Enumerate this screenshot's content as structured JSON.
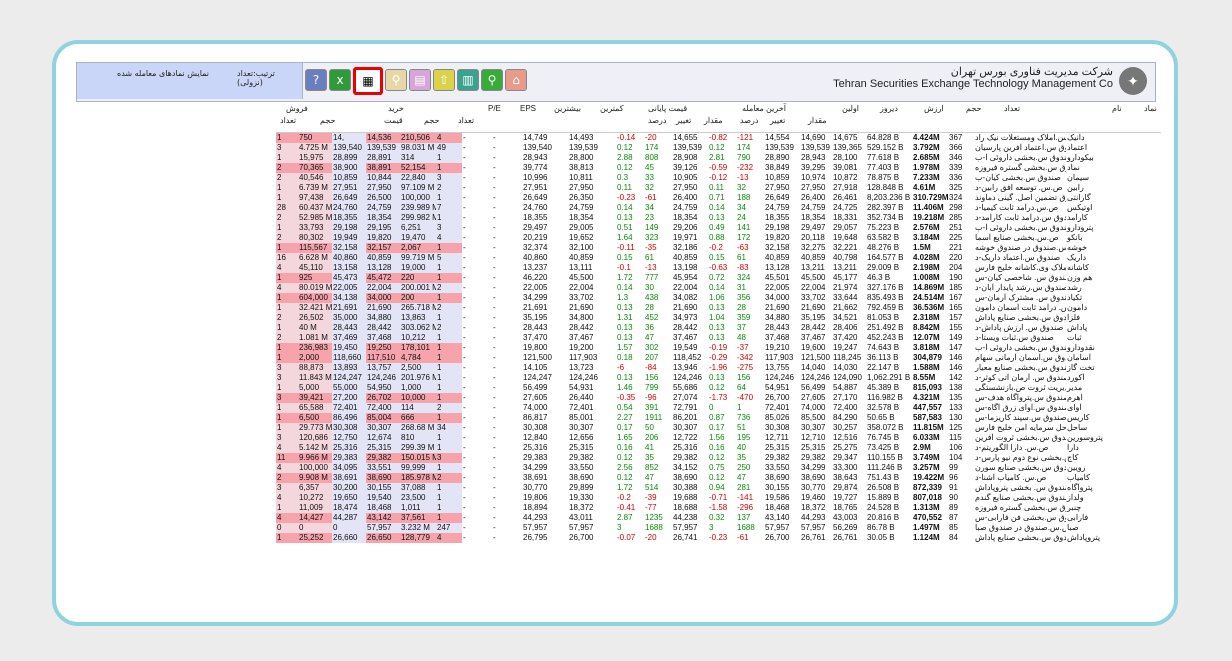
{
  "header": {
    "company_fa": "شرکت مدیریت فناوری بورس تهران",
    "company_en": "Tehran Securities Exchange Technology Management Co",
    "show_traded": "نمایش نمادهای معامله شده",
    "sort_label": "ترتیب:تعداد (نزولی)"
  },
  "toolbar": [
    "?",
    "x",
    "▦",
    "▥",
    "▤",
    "⌂",
    "▣",
    "⚲",
    "⌂"
  ],
  "columns": {
    "sell_group": "فروش",
    "sell_count": "تعداد",
    "sell_volume": "حجم",
    "buy_group": "خرید",
    "buy_price": "قیمت",
    "buy_volume": "حجم",
    "buy_count": "تعداد",
    "pe": "P/E",
    "eps": "EPS",
    "max": "بیشترین",
    "min": "کمترین",
    "close_group": "قیمت پایانی",
    "close_pct": "درصد",
    "close_change": "تغییر",
    "last_group": "آخرین معامله",
    "last_amount": "مقدار",
    "last_pct": "درصد",
    "last_change": "تغییر",
    "amount": "مقدار",
    "first": "اولین",
    "yesterday": "دیروز",
    "value": "ارزش",
    "volume": "حجم",
    "count": "تعداد",
    "name": "نام",
    "symbol": "نماد"
  },
  "rows": [
    [
      "1",
      "750",
      "14,",
      "14,536",
      "210,506",
      "4",
      "-",
      "-",
      "14,749",
      "14,493",
      "-0.14",
      "-20",
      "14,655",
      "-0.82",
      "-121",
      "14,554",
      "14,690",
      "14,675",
      "64.828 B",
      "4.424M",
      "367",
      "ص.س.املاک ومستغلات نیک راد",
      "دانیک"
    ],
    [
      "3",
      "4.725 M",
      "139,540",
      "139,539",
      "98.031 M",
      "49",
      "-",
      "-",
      "139,540",
      "139,539",
      "0.12",
      "174",
      "139,539",
      "0.12",
      "174",
      "139,539",
      "139,539",
      "139,365",
      "529.152 B",
      "3.792M",
      "366",
      "صندوق س.اعتماد آفرین پارسیان",
      "اعتماد"
    ],
    [
      "1",
      "15,975",
      "28,899",
      "28,891",
      "314",
      "1",
      "-",
      "-",
      "28,943",
      "28,800",
      "2.88",
      "808",
      "28,908",
      "2.81",
      "790",
      "28,890",
      "28,943",
      "28,100",
      "77.618 B",
      "2.685M",
      "346",
      "صندوق س.بخشی داروئی آ-ب",
      "بیکودارو"
    ],
    [
      "2",
      "70,365",
      "38,900",
      "38,891",
      "52,154",
      "1",
      "-",
      "-",
      "39,774",
      "38,813",
      "0.12",
      "45",
      "39,126",
      "-0.59",
      "-232",
      "38,849",
      "39,295",
      "39,081",
      "77.403 B",
      "1.978M",
      "339",
      "صندوق س.بخشی گستره فیروزه",
      "نماد"
    ],
    [
      "2",
      "40,546",
      "10,859",
      "10,844",
      "22,840",
      "3",
      "-",
      "-",
      "10,996",
      "10,811",
      "0.3",
      "33",
      "10,905",
      "-0.12",
      "-13",
      "10,859",
      "10,974",
      "10,872",
      "78.875 B",
      "7.233M",
      "336",
      "صندوق س.بخشی کیان-ب",
      "سیمان"
    ],
    [
      "1",
      "6.739 M",
      "27,951",
      "27,950",
      "97.109 M",
      "2",
      "-",
      "-",
      "27,951",
      "27,950",
      "0.11",
      "32",
      "27,950",
      "0.11",
      "32",
      "27,950",
      "27,950",
      "27,918",
      "128.848 B",
      "4.61M",
      "325",
      "ص.س. توسعه افق رابین-د",
      "رابین"
    ],
    [
      "1",
      "97,438",
      "26,649",
      "26,500",
      "100,000",
      "1",
      "-",
      "-",
      "26,649",
      "26,350",
      "-0.23",
      "-61",
      "26,400",
      "0.71",
      "188",
      "26,649",
      "26,400",
      "26,461",
      "8,203.236 B",
      "310.729M",
      "324",
      "صندوق تضمین اصل. گینی دماوند",
      "گارانتی"
    ],
    [
      "28",
      "60.437 M",
      "24,760",
      "24,759",
      "239.989 M",
      "7",
      "-",
      "-",
      "24,760",
      "24,759",
      "0.14",
      "34",
      "24,759",
      "0.14",
      "34",
      "24,759",
      "24,759",
      "24,725",
      "282.397 B",
      "11.406M",
      "298",
      "ص.س.درآمد ثابت کیمیا-د",
      "اوتیکس"
    ],
    [
      "2",
      "52.985 M",
      "18,355",
      "18,354",
      "299.982 M",
      "1",
      "-",
      "-",
      "18,355",
      "18,354",
      "0.13",
      "23",
      "18,354",
      "0.13",
      "24",
      "18,355",
      "18,354",
      "18,331",
      "352.734 B",
      "19.218M",
      "285",
      "صندوق س.درآمد ثابت کارآمد-د",
      "کارآمد"
    ],
    [
      "1",
      "33,793",
      "29,198",
      "29,195",
      "6,251",
      "3",
      "-",
      "-",
      "29,497",
      "29,005",
      "0.51",
      "149",
      "29,206",
      "0.49",
      "141",
      "29,198",
      "29,497",
      "29,057",
      "75.223 B",
      "2.576M",
      "251",
      "صندوق س.بخشی داروئی آ-ب",
      "پترودارو"
    ],
    [
      "2",
      "80,302",
      "19,949",
      "19,820",
      "19,470",
      "4",
      "-",
      "-",
      "20,219",
      "19,652",
      "1.64",
      "323",
      "19,971",
      "0.88",
      "172",
      "19,820",
      "20,118",
      "19,648",
      "63.582 B",
      "3.184M",
      "225",
      "ص.س.بخشی صنایع آسما",
      "بانکو"
    ],
    [
      "1",
      "115,567",
      "32,158",
      "32,157",
      "2,067",
      "1",
      "-",
      "-",
      "32,374",
      "32,100",
      "-0.11",
      "-35",
      "32,186",
      "-0.2",
      "-63",
      "32,158",
      "32,275",
      "32,221",
      "48.276 B",
      "1.5M",
      "221",
      "ص.س.صندوق در صندوق خوشه",
      "خوشه"
    ],
    [
      "16",
      "6.628 M",
      "40,860",
      "40,859",
      "99.719 M",
      "5",
      "-",
      "-",
      "40,860",
      "40,859",
      "0.15",
      "61",
      "40,859",
      "0.15",
      "61",
      "40,859",
      "40,859",
      "40,798",
      "164.577 B",
      "4.028M",
      "220",
      "صندوق س.اعتماد داریک-د",
      "داریک"
    ],
    [
      "4",
      "45,110",
      "13,158",
      "13,128",
      "19,000",
      "1",
      "-",
      "-",
      "13,237",
      "13,111",
      "-0.1",
      "-13",
      "13,198",
      "-0.63",
      "-83",
      "13,128",
      "13,211",
      "13,211",
      "29.009 B",
      "2.198M",
      "204",
      "ص.س. املاک وی.کاشانه خلیج فارس",
      "کاشانه"
    ],
    [
      "1",
      "925",
      "45,473",
      "45,472",
      "220",
      "1",
      "-",
      "-",
      "46,220",
      "45,500",
      "1.72",
      "777",
      "45,954",
      "0.72",
      "324",
      "45,501",
      "45,500",
      "45,177",
      "46.3 B",
      "1.008M",
      "190",
      "صندوق س. شاخصی کیان-س",
      "هم وزن"
    ],
    [
      "4",
      "80.019 M",
      "22,005",
      "22,004",
      "200.001 M",
      "2",
      "-",
      "-",
      "22,005",
      "22,004",
      "0.14",
      "30",
      "22,004",
      "0.14",
      "31",
      "22,005",
      "22,004",
      "21,974",
      "327.176 B",
      "14.869M",
      "185",
      "صندوق س.رشد پایدار آبان-د",
      "رشد"
    ],
    [
      "1",
      "604,000",
      "34,138",
      "34,000",
      "200",
      "1",
      "-",
      "-",
      "34,299",
      "33,702",
      "1.3",
      "438",
      "34,082",
      "1.06",
      "356",
      "34,000",
      "33,702",
      "33,644",
      "835.493 B",
      "24.514M",
      "167",
      "صندوق س. مشترک آرمان-س",
      "تکیاد"
    ],
    [
      "1",
      "32.421 M",
      "21,691",
      "21,690",
      "265.718 M",
      "2",
      "-",
      "-",
      "21,691",
      "21,690",
      "0.13",
      "28",
      "21,690",
      "0.13",
      "28",
      "21,690",
      "21,690",
      "21,662",
      "792.459 B",
      "36.536M",
      "165",
      "ص.س. درآمد ثابت آسمان دامون",
      "دامون"
    ],
    [
      "2",
      "26,502",
      "35,000",
      "34,880",
      "13,863",
      "1",
      "-",
      "-",
      "35,195",
      "34,800",
      "1.31",
      "452",
      "34,973",
      "1.04",
      "359",
      "34,880",
      "35,195",
      "34,521",
      "81.053 B",
      "2.318M",
      "157",
      "صندوق س.بخشی صنایع پاداش",
      "فلزا"
    ],
    [
      "1",
      "40 M",
      "28,443",
      "28,442",
      "303.062 M",
      "2",
      "-",
      "-",
      "28,443",
      "28,442",
      "0.13",
      "36",
      "28,442",
      "0.13",
      "37",
      "28,443",
      "28,442",
      "28,406",
      "251.492 B",
      "8.842M",
      "155",
      "صندوق س. ارزش پاداش-د",
      "پاداش"
    ],
    [
      "2",
      "1.081 M",
      "37,469",
      "37,468",
      "10,212",
      "1",
      "-",
      "-",
      "37,470",
      "37,467",
      "0.13",
      "47",
      "37,467",
      "0.13",
      "48",
      "37,468",
      "37,467",
      "37,420",
      "452.243 B",
      "12.07M",
      "149",
      "صندوق س.ثبات ویستا-د",
      "ثبات"
    ],
    [
      "1",
      "236,983",
      "19,450",
      "19,250",
      "178,101",
      "1",
      "-",
      "-",
      "19,800",
      "19,200",
      "1.57",
      "302",
      "19,549",
      "-0.19",
      "-37",
      "19,210",
      "19,600",
      "19,247",
      "74.643 B",
      "3.818M",
      "147",
      "صندوق س.بخشی داروئی آ-ب",
      "نقدودارو"
    ],
    [
      "1",
      "2,000",
      "118,660",
      "117,510",
      "4,784",
      "1",
      "-",
      "-",
      "121,500",
      "117,903",
      "0.18",
      "207",
      "118,452",
      "-0.29",
      "-342",
      "117,903",
      "121,500",
      "118,245",
      "36.113 B",
      "304,879",
      "146",
      "صندوق س.آسمان آرمانی سهام",
      "آسامان"
    ],
    [
      "3",
      "88,873",
      "13,893",
      "13,757",
      "2,500",
      "1",
      "-",
      "-",
      "14,105",
      "13,723",
      "-6",
      "-84",
      "13,946",
      "-1.96",
      "-275",
      "13,755",
      "14,040",
      "14,030",
      "22.147 B",
      "1.588M",
      "146",
      "صندوق س.بخشی صنایع معیار",
      "تخت گاز"
    ],
    [
      "3",
      "11.843 M",
      "124,247",
      "124,246",
      "201.976 M",
      "1",
      "-",
      "-",
      "124,247",
      "124,246",
      "0.13",
      "156",
      "124,246",
      "0.13",
      "156",
      "124,246",
      "124,246",
      "124,090",
      "1,062.291 B",
      "8.55M",
      "142",
      "صندوق س. آرمان آتی کوثر-د",
      "آکورد"
    ],
    [
      "1",
      "5,000",
      "55,000",
      "54,950",
      "1,000",
      "1",
      "-",
      "-",
      "56,499",
      "54,931",
      "1.46",
      "799",
      "55,686",
      "0.12",
      "64",
      "54,951",
      "56,499",
      "54,887",
      "45.389 B",
      "815,093",
      "138",
      "صندوق س.مدیریت ثروت ص.بازنشستگی",
      "مدیر"
    ],
    [
      "3",
      "39,421",
      "27,200",
      "26,702",
      "10,000",
      "1",
      "-",
      "-",
      "27,605",
      "26,440",
      "-0.35",
      "-96",
      "27,074",
      "-1.73",
      "-470",
      "26,700",
      "27,605",
      "27,170",
      "116.982 B",
      "4.321M",
      "135",
      "صندوق س.پتروآگاه هدف-س",
      "اهرم"
    ],
    [
      "1",
      "65,588",
      "72,401",
      "72,400",
      "114",
      "2",
      "-",
      "-",
      "74,000",
      "72,401",
      "0.54",
      "391",
      "72,791",
      "0",
      "1",
      "72,401",
      "74,000",
      "72,400",
      "32.578 B",
      "447,557",
      "133",
      "صندوق س.آوای زرق آگاه-س",
      "آوای"
    ],
    [
      "1",
      "6,500",
      "86,496",
      "85,004",
      "666",
      "1",
      "-",
      "-",
      "86,817",
      "85,001",
      "2.27",
      "1911",
      "86,201",
      "0.87",
      "736",
      "85,026",
      "85,500",
      "84,290",
      "50.65 B",
      "587,583",
      "130",
      "صندوق س.سپند کاریزما-س",
      "کاریس"
    ],
    [
      "1",
      "29.773 M",
      "30,308",
      "30,307",
      "268.68 M",
      "34",
      "-",
      "-",
      "30,308",
      "30,307",
      "0.17",
      "50",
      "30,307",
      "0.17",
      "51",
      "30,308",
      "30,307",
      "30,257",
      "358.072 B",
      "11.815M",
      "125",
      "ص.س.ساحل سرمایه امن خلیج فارس",
      "ساحل"
    ],
    [
      "3",
      "120,686",
      "12,750",
      "12,674",
      "810",
      "1",
      "-",
      "-",
      "12,840",
      "12,656",
      "1.65",
      "206",
      "12,722",
      "1.56",
      "195",
      "12,711",
      "12,710",
      "12,516",
      "76.745 B",
      "6.033M",
      "115",
      "صندوق س.بخشی ثروت آفرین",
      "پتروسورین"
    ],
    [
      "4",
      "5.142 M",
      "25,316",
      "25,315",
      "299.39 M",
      "1",
      "-",
      "-",
      "25,316",
      "25,315",
      "0.16",
      "41",
      "25,316",
      "0.16",
      "40",
      "25,315",
      "25,315",
      "25,275",
      "73.425 B",
      "2.9M",
      "106",
      "ص.س. دارا الگوریتم-د",
      "دارا"
    ],
    [
      "11",
      "9.966 M",
      "29,383",
      "29,382",
      "150.015 M",
      "3",
      "-",
      "-",
      "29,383",
      "29,382",
      "0.12",
      "35",
      "29,382",
      "0.12",
      "35",
      "29,382",
      "29,382",
      "29,347",
      "110.155 B",
      "3.749M",
      "104",
      "صندوق س.بخشی نوع دوم نیو پارس-د",
      "کاج"
    ],
    [
      "4",
      "100,000",
      "34,095",
      "33,551",
      "99,999",
      "1",
      "-",
      "-",
      "34,299",
      "33,550",
      "2.56",
      "852",
      "34,152",
      "0.75",
      "250",
      "33,550",
      "34,299",
      "33,300",
      "111.246 B",
      "3.257M",
      "99",
      "صندوق س.بخشی صنایع سورن",
      "رویین"
    ],
    [
      "2",
      "9.908 M",
      "38,691",
      "38,690",
      "185.978 M",
      "2",
      "-",
      "-",
      "38,691",
      "38,690",
      "0.12",
      "47",
      "38,690",
      "0.12",
      "47",
      "38,690",
      "38,690",
      "38,643",
      "751.43 B",
      "19.422M",
      "96",
      "ص.س. کامیاب آشنا-د",
      "کامیاب"
    ],
    [
      "3",
      "6,357",
      "30,200",
      "30,155",
      "37,088",
      "1",
      "-",
      "-",
      "30,770",
      "29,899",
      "1.72",
      "514",
      "30,388",
      "0.94",
      "281",
      "30,155",
      "30,770",
      "29,874",
      "26.508 B",
      "872,339",
      "91",
      "صندوق س. بخشی پتروپاداش",
      "پتروآگاه"
    ],
    [
      "4",
      "10,272",
      "19,650",
      "19,540",
      "23,500",
      "1",
      "-",
      "-",
      "19,806",
      "19,330",
      "-0.2",
      "-39",
      "19,688",
      "-0.71",
      "-141",
      "19,586",
      "19,460",
      "19,727",
      "15.889 B",
      "807,018",
      "90",
      "صندوق س.بخشی صنایع گندم",
      "ولداز"
    ],
    [
      "1",
      "11,009",
      "18,474",
      "18,468",
      "1,011",
      "1",
      "-",
      "-",
      "18,894",
      "18,372",
      "-0.41",
      "-77",
      "18,688",
      "-1.58",
      "-296",
      "18,468",
      "18,372",
      "18,765",
      "24.528 B",
      "1.313M",
      "89",
      "صندوق س.بخشی گستره فیروزه",
      "چنبر"
    ],
    [
      "4",
      "14,427",
      "44,287",
      "43,142",
      "37,561",
      "1",
      "-",
      "-",
      "44,293",
      "43,011",
      "2.87",
      "1235",
      "44,238",
      "0.32",
      "137",
      "43,140",
      "44,293",
      "43,003",
      "20.816 B",
      "470,552",
      "87",
      "صندوق س.بخشی فن فارابی-س",
      "فارابی"
    ],
    [
      "0",
      "0",
      "0",
      "57,957",
      "3.232 M",
      "247",
      "-",
      "-",
      "57,957",
      "57,957",
      "3",
      "1688",
      "57,957",
      "3",
      "1688",
      "57,957",
      "57,957",
      "56,269",
      "86.78 B",
      "1.497M",
      "85",
      "ص.س.صندوق در صندوق صبا",
      "صبا"
    ],
    [
      "1",
      "25,252",
      "26,660",
      "26,650",
      "128,779",
      "4",
      "-",
      "-",
      "26,795",
      "26,700",
      "-0.07",
      "-20",
      "26,741",
      "-0.23",
      "-61",
      "26,700",
      "26,761",
      "26,761",
      "30.05 B",
      "1.124M",
      "84",
      "صندوق س.بخشی صنایع پاداش",
      "پتروپاداش"
    ]
  ],
  "highlight_rows": [
    0,
    3,
    11,
    14,
    16,
    21,
    22,
    26,
    28,
    32,
    34,
    38,
    40
  ],
  "colors": {
    "pink": "#f4d7dd",
    "highlight": "#f6a3ab",
    "lavender": "#e4e4f7",
    "positive": "#0a8a0a",
    "negative": "#d00000",
    "frame": "#8fd3de"
  }
}
